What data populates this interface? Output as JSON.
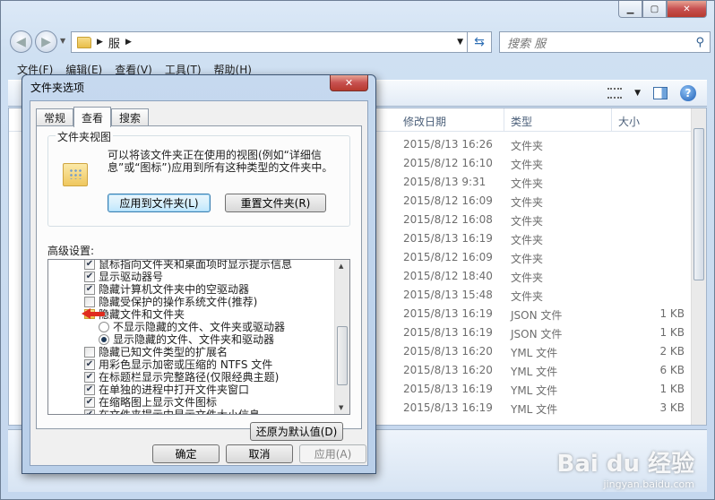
{
  "explorer": {
    "address_folder": "服",
    "search_placeholder": "搜索 服",
    "menu": [
      "文件(F)",
      "编辑(E)",
      "查看(V)",
      "工具(T)",
      "帮助(H)"
    ],
    "columns": {
      "date": "修改日期",
      "type": "类型",
      "size": "大小"
    },
    "rows": [
      {
        "date": "2015/8/13 16:26",
        "type": "文件夹",
        "size": ""
      },
      {
        "date": "2015/8/12 16:10",
        "type": "文件夹",
        "size": ""
      },
      {
        "date": "2015/8/13 9:31",
        "type": "文件夹",
        "size": ""
      },
      {
        "date": "2015/8/12 16:09",
        "type": "文件夹",
        "size": ""
      },
      {
        "date": "2015/8/12 16:08",
        "type": "文件夹",
        "size": ""
      },
      {
        "date": "2015/8/13 16:19",
        "type": "文件夹",
        "size": ""
      },
      {
        "date": "2015/8/12 16:09",
        "type": "文件夹",
        "size": ""
      },
      {
        "date": "2015/8/12 18:40",
        "type": "文件夹",
        "size": ""
      },
      {
        "date": "2015/8/13 15:48",
        "type": "文件夹",
        "size": ""
      },
      {
        "date": "2015/8/13 16:19",
        "type": "JSON 文件",
        "size": "1 KB"
      },
      {
        "date": "2015/8/13 16:19",
        "type": "JSON 文件",
        "size": "1 KB"
      },
      {
        "date": "2015/8/13 16:20",
        "type": "YML 文件",
        "size": "2 KB"
      },
      {
        "date": "2015/8/13 16:20",
        "type": "YML 文件",
        "size": "6 KB"
      },
      {
        "date": "2015/8/13 16:19",
        "type": "YML 文件",
        "size": "1 KB"
      },
      {
        "date": "2015/8/13 16:19",
        "type": "YML 文件",
        "size": "3 KB"
      }
    ]
  },
  "dialog": {
    "title": "文件夹选项",
    "tabs": [
      "常规",
      "查看",
      "搜索"
    ],
    "active_tab": "查看",
    "folder_views_label": "文件夹视图",
    "folder_views_desc": "可以将该文件夹正在使用的视图(例如“详细信息”或“图标”)应用到所有这种类型的文件夹中。",
    "apply_button": "应用到文件夹(L)",
    "reset_button": "重置文件夹(R)",
    "advanced_label": "高级设置:",
    "settings": [
      {
        "kind": "checkbox",
        "checked": true,
        "indent": 0,
        "label": "鼠标指向文件夹和桌面项时显示提示信息"
      },
      {
        "kind": "checkbox",
        "checked": true,
        "indent": 0,
        "label": "显示驱动器号"
      },
      {
        "kind": "checkbox",
        "checked": true,
        "indent": 0,
        "label": "隐藏计算机文件夹中的空驱动器"
      },
      {
        "kind": "checkbox",
        "checked": false,
        "indent": 0,
        "label": "隐藏受保护的操作系统文件(推荐)"
      },
      {
        "kind": "folder",
        "checked": false,
        "indent": 0,
        "label": "隐藏文件和文件夹"
      },
      {
        "kind": "radio",
        "checked": false,
        "indent": 1,
        "label": "不显示隐藏的文件、文件夹或驱动器"
      },
      {
        "kind": "radio",
        "checked": true,
        "indent": 1,
        "label": "显示隐藏的文件、文件夹和驱动器"
      },
      {
        "kind": "checkbox",
        "checked": false,
        "indent": 0,
        "label": "隐藏已知文件类型的扩展名"
      },
      {
        "kind": "checkbox",
        "checked": true,
        "indent": 0,
        "label": "用彩色显示加密或压缩的 NTFS 文件"
      },
      {
        "kind": "checkbox",
        "checked": true,
        "indent": 0,
        "label": "在标题栏显示完整路径(仅限经典主题)"
      },
      {
        "kind": "checkbox",
        "checked": true,
        "indent": 0,
        "label": "在单独的进程中打开文件夹窗口"
      },
      {
        "kind": "checkbox",
        "checked": true,
        "indent": 0,
        "label": "在缩略图上显示文件图标"
      },
      {
        "kind": "checkbox",
        "checked": true,
        "indent": 0,
        "label": "在文件夹提示中显示文件大小信息"
      }
    ],
    "restore_button": "还原为默认值(D)",
    "ok_button": "确定",
    "cancel_button": "取消",
    "apply_disabled_button": "应用(A)"
  },
  "watermark": {
    "brand": "Bai du 经验",
    "url": "jingyan.baidu.com"
  }
}
